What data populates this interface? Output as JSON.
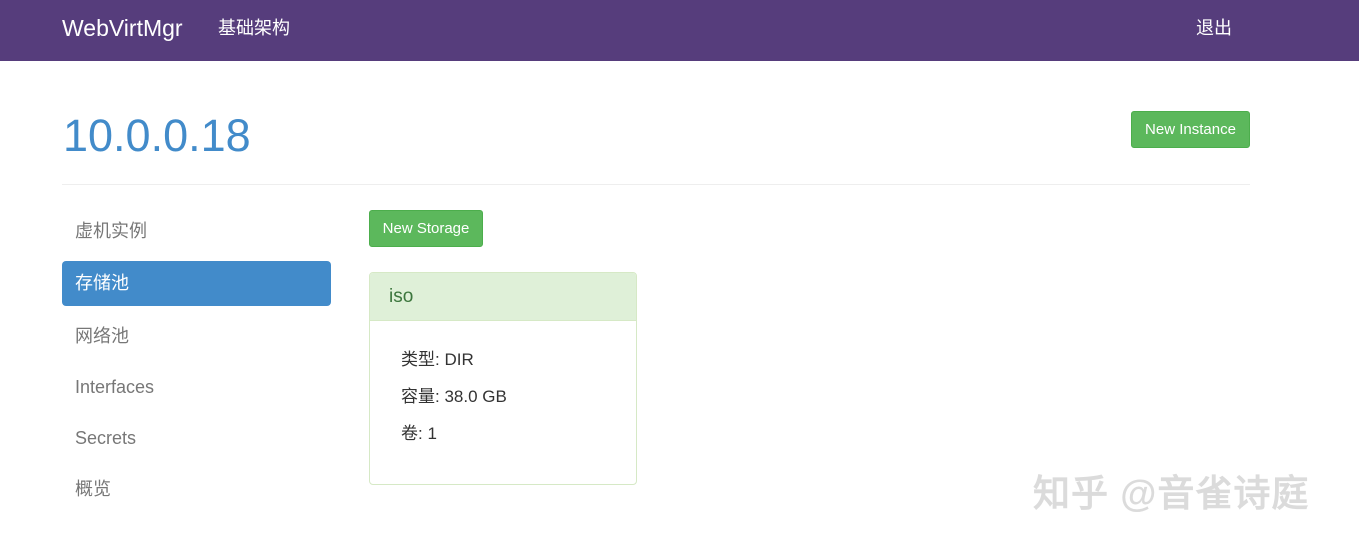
{
  "navbar": {
    "brand": "WebVirtMgr",
    "infrastructure_label": "基础架构",
    "logout_label": "退出"
  },
  "header": {
    "host_title": "10.0.0.18",
    "new_instance_label": "New Instance"
  },
  "sidebar": {
    "items": [
      {
        "label": "虚机实例"
      },
      {
        "label": "存储池"
      },
      {
        "label": "网络池"
      },
      {
        "label": "Interfaces"
      },
      {
        "label": "Secrets"
      },
      {
        "label": "概览"
      }
    ]
  },
  "main": {
    "new_storage_label": "New Storage",
    "pool": {
      "name": "iso",
      "type_label": "类型: DIR",
      "capacity_label": "容量: 38.0 GB",
      "volumes_label": "卷: 1"
    }
  },
  "watermark": "知乎 @音雀诗庭",
  "colors": {
    "navbar": "#563d7c",
    "primary": "#428bca",
    "success": "#5cb85c",
    "panel_heading": "#dff0d8"
  }
}
